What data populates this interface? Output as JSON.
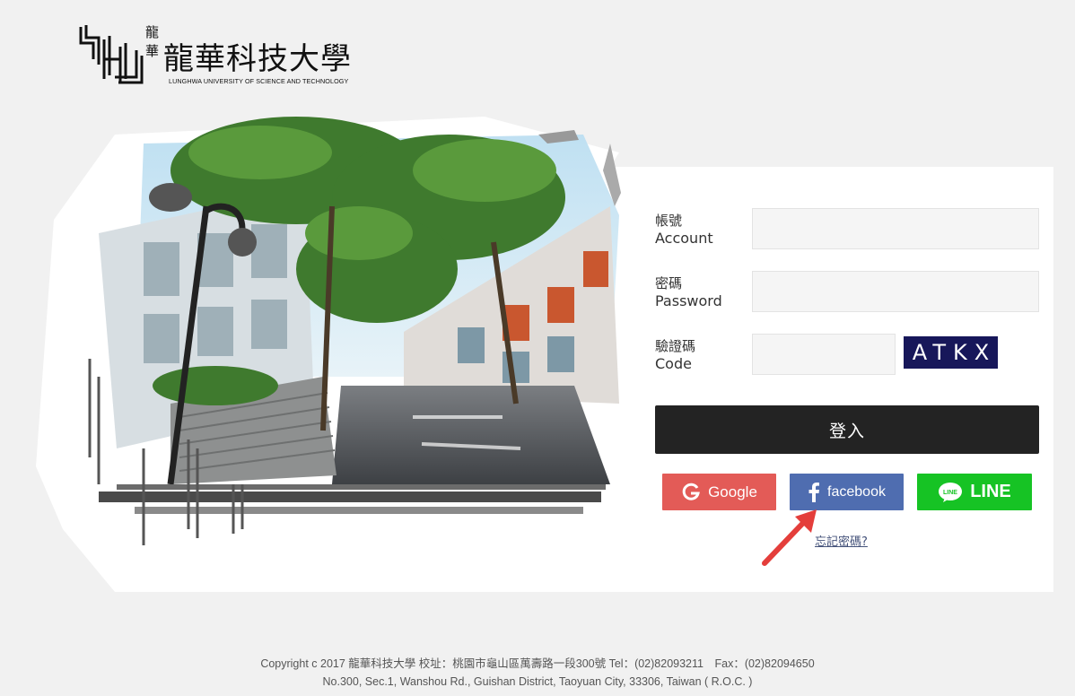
{
  "logo": {
    "small_chars": "龍華",
    "title": "龍華科技大學",
    "subtitle": "LUNGHWA UNIVERSITY OF SCIENCE AND TECHNOLOGY"
  },
  "form": {
    "account": {
      "label_zh": "帳號",
      "label_en": "Account",
      "value": ""
    },
    "password": {
      "label_zh": "密碼",
      "label_en": "Password",
      "value": ""
    },
    "code": {
      "label_zh": "驗證碼",
      "label_en": "Code",
      "value": "",
      "captcha_text": "ATKX"
    },
    "login_label": "登入",
    "forgot_label": "忘記密碼?"
  },
  "social": {
    "google_label": "Google",
    "facebook_label": "facebook",
    "line_label": "LINE",
    "colors": {
      "google": "#e35b57",
      "facebook": "#4f6db0",
      "line": "#16c324"
    }
  },
  "footer": {
    "line1": "Copyright c 2017 龍華科技大學 校址：桃園市龜山區萬壽路一段300號 Tel：(02)82093211　Fax：(02)82094650",
    "line2": "No.300, Sec.1, Wanshou Rd., Guishan District, Taoyuan City, 33306, Taiwan ( R.O.C. )"
  }
}
